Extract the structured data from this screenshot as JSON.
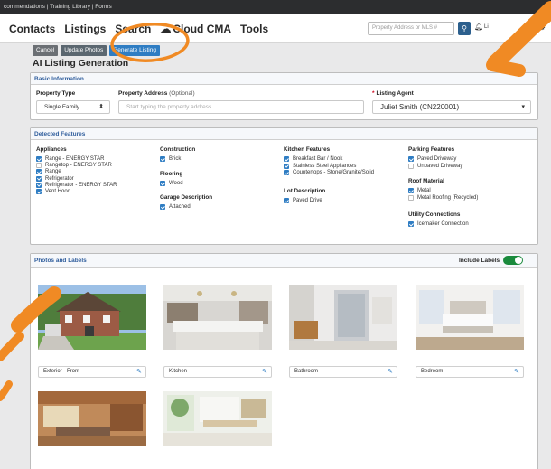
{
  "top_strip": {
    "breadcrumb": "commendations | Training Library | Forms"
  },
  "nav": {
    "items": [
      "Contacts",
      "Listings",
      "Search",
      "Cloud CMA",
      "Tools"
    ],
    "search_placeholder": "Property Address or MLS #",
    "right_text": "Li"
  },
  "toolbar": {
    "cancel": "Cancel",
    "update_photos": "Update Photos",
    "generate": "Generate Listing"
  },
  "page_title": "AI Listing Generation",
  "basic_info": {
    "heading": "Basic Information",
    "property_type_label": "Property Type",
    "property_type_value": "Single Family",
    "address_label": "Property Address",
    "address_optional": "(Optional)",
    "address_placeholder": "Start typing the property address",
    "agent_label": "Listing Agent",
    "agent_value": "Juliet Smith (CN220001)"
  },
  "detected_features": {
    "heading": "Detected Features",
    "appliances": {
      "title": "Appliances",
      "items": [
        {
          "label": "Range - ENERGY STAR",
          "checked": true
        },
        {
          "label": "Rangetop - ENERGY STAR",
          "checked": false
        },
        {
          "label": "Range",
          "checked": true
        },
        {
          "label": "Refrigerator",
          "checked": true
        },
        {
          "label": "Refrigerator - ENERGY STAR",
          "checked": true
        },
        {
          "label": "Vent Hood",
          "checked": true
        }
      ]
    },
    "construction": {
      "title": "Construction",
      "items": [
        {
          "label": "Brick",
          "checked": true
        }
      ]
    },
    "flooring": {
      "title": "Flooring",
      "items": [
        {
          "label": "Wood",
          "checked": true
        }
      ]
    },
    "garage": {
      "title": "Garage Description",
      "items": [
        {
          "label": "Attached",
          "checked": true
        }
      ]
    },
    "kitchen": {
      "title": "Kitchen Features",
      "items": [
        {
          "label": "Breakfast Bar / Nook",
          "checked": true
        },
        {
          "label": "Stainless Steel Appliances",
          "checked": true
        },
        {
          "label": "Countertops - Stone/Granite/Solid",
          "checked": true
        }
      ]
    },
    "lot": {
      "title": "Lot Description",
      "items": [
        {
          "label": "Paved Drive",
          "checked": true
        }
      ]
    },
    "parking": {
      "title": "Parking Features",
      "items": [
        {
          "label": "Paved Driveway",
          "checked": true
        },
        {
          "label": "Unpaved Driveway",
          "checked": false
        }
      ]
    },
    "roof": {
      "title": "Roof Material",
      "items": [
        {
          "label": "Metal",
          "checked": true
        },
        {
          "label": "Metal Roofing (Recycled)",
          "checked": false
        }
      ]
    },
    "utility": {
      "title": "Utility Connections",
      "items": [
        {
          "label": "Icemaker Connection",
          "checked": true
        }
      ]
    }
  },
  "photos": {
    "heading": "Photos and Labels",
    "include_labels": "Include Labels",
    "include_labels_on": true,
    "captions": [
      "Exterior - Front",
      "Kitchen",
      "Bathroom",
      "Bedroom"
    ]
  },
  "colors": {
    "accent": "#2f7dc3",
    "toggle": "#1a8a3c",
    "annotation": "#f08a24",
    "nav_button": "#2c5f8d"
  }
}
